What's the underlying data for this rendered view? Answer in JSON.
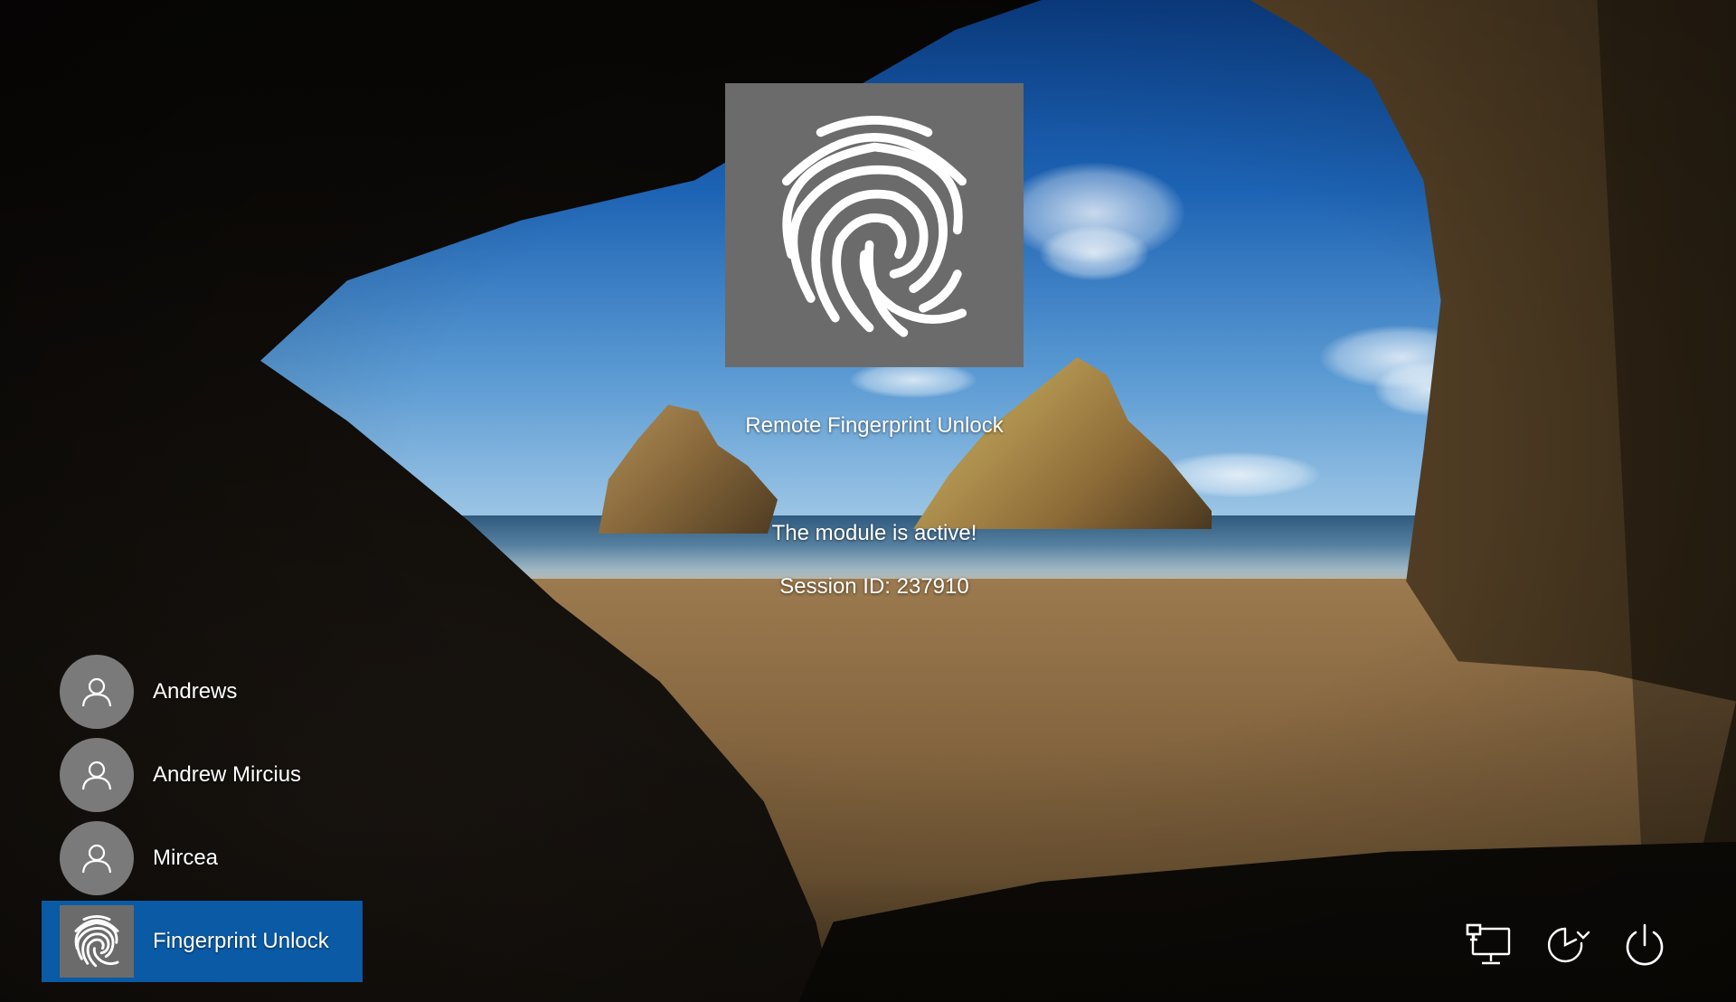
{
  "login": {
    "tile_icon": "fingerprint-icon",
    "title": "Remote Fingerprint Unlock",
    "status": "The module is active!",
    "session": "Session ID: 237910"
  },
  "users": [
    {
      "label": "Andrews",
      "icon": "user-avatar-icon",
      "selected": false
    },
    {
      "label": "Andrew Mircius",
      "icon": "user-avatar-icon",
      "selected": false
    },
    {
      "label": "Mircea",
      "icon": "user-avatar-icon",
      "selected": false
    },
    {
      "label": "Fingerprint Unlock",
      "icon": "fingerprint-icon",
      "selected": true
    }
  ],
  "system_icons": [
    "network-icon",
    "ease-of-access-icon",
    "power-icon"
  ],
  "colors": {
    "selected_user_bg": "#0a5aa5",
    "tile_bg": "#6b6b6b",
    "avatar_bg": "#7a7a7a",
    "text": "#ffffff"
  }
}
